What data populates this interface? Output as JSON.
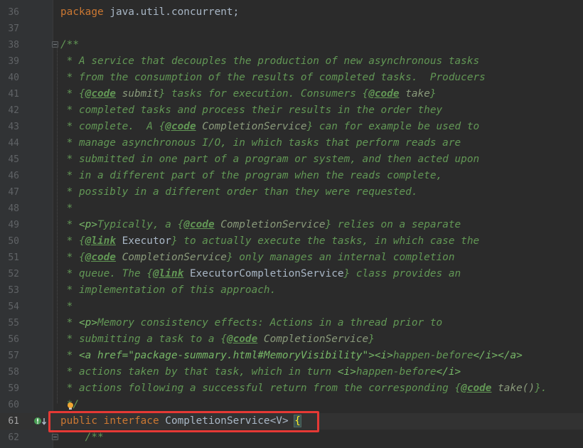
{
  "editor": {
    "file_language": "java",
    "lines": [
      {
        "num": "36",
        "segments": [
          {
            "t": "kw",
            "v": "package"
          },
          {
            "t": "ident",
            "v": " java.util.concurrent;"
          }
        ]
      },
      {
        "num": "37",
        "segments": []
      },
      {
        "num": "38",
        "segments": [
          {
            "t": "cm",
            "v": "/**"
          }
        ]
      },
      {
        "num": "39",
        "segments": [
          {
            "t": "cm",
            "v": " * A service that decouples the production of new asynchronous tasks"
          }
        ]
      },
      {
        "num": "40",
        "segments": [
          {
            "t": "cm",
            "v": " * from the consumption of the results of completed tasks.  Producers"
          }
        ]
      },
      {
        "num": "41",
        "segments": [
          {
            "t": "cm",
            "v": " * {"
          },
          {
            "t": "tg",
            "v": "@code"
          },
          {
            "t": "ref",
            "v": " submit"
          },
          {
            "t": "cm",
            "v": "} tasks for execution. Consumers {"
          },
          {
            "t": "tg",
            "v": "@code"
          },
          {
            "t": "ref",
            "v": " take"
          },
          {
            "t": "cm",
            "v": "}"
          }
        ]
      },
      {
        "num": "42",
        "segments": [
          {
            "t": "cm",
            "v": " * completed tasks and process their results in the order they"
          }
        ]
      },
      {
        "num": "43",
        "segments": [
          {
            "t": "cm",
            "v": " * complete.  A {"
          },
          {
            "t": "tg",
            "v": "@code"
          },
          {
            "t": "ref",
            "v": " CompletionService"
          },
          {
            "t": "cm",
            "v": "} can for example be used to"
          }
        ]
      },
      {
        "num": "44",
        "segments": [
          {
            "t": "cm",
            "v": " * manage asynchronous I/O, in which tasks that perform reads are"
          }
        ]
      },
      {
        "num": "45",
        "segments": [
          {
            "t": "cm",
            "v": " * submitted in one part of a program or system, and then acted upon"
          }
        ]
      },
      {
        "num": "46",
        "segments": [
          {
            "t": "cm",
            "v": " * in a different part of the program when the reads complete,"
          }
        ]
      },
      {
        "num": "47",
        "segments": [
          {
            "t": "cm",
            "v": " * possibly in a different order than they were requested."
          }
        ]
      },
      {
        "num": "48",
        "segments": [
          {
            "t": "cm",
            "v": " *"
          }
        ]
      },
      {
        "num": "49",
        "segments": [
          {
            "t": "cm",
            "v": " * "
          },
          {
            "t": "html-tag",
            "v": "<p>"
          },
          {
            "t": "cm",
            "v": "Typically, a {"
          },
          {
            "t": "tg",
            "v": "@code"
          },
          {
            "t": "ref",
            "v": " CompletionService"
          },
          {
            "t": "cm",
            "v": "} relies on a separate"
          }
        ]
      },
      {
        "num": "50",
        "segments": [
          {
            "t": "cm",
            "v": " * {"
          },
          {
            "t": "tg",
            "v": "@link"
          },
          {
            "t": "ident",
            "v": " Executor"
          },
          {
            "t": "cm",
            "v": "} to actually execute the tasks, in which case the"
          }
        ]
      },
      {
        "num": "51",
        "segments": [
          {
            "t": "cm",
            "v": " * {"
          },
          {
            "t": "tg",
            "v": "@code"
          },
          {
            "t": "ref",
            "v": " CompletionService"
          },
          {
            "t": "cm",
            "v": "} only manages an internal completion"
          }
        ]
      },
      {
        "num": "52",
        "segments": [
          {
            "t": "cm",
            "v": " * queue. The {"
          },
          {
            "t": "tg",
            "v": "@link"
          },
          {
            "t": "ident",
            "v": " ExecutorCompletionService"
          },
          {
            "t": "cm",
            "v": "} class provides an"
          }
        ]
      },
      {
        "num": "53",
        "segments": [
          {
            "t": "cm",
            "v": " * implementation of this approach."
          }
        ]
      },
      {
        "num": "54",
        "segments": [
          {
            "t": "cm",
            "v": " *"
          }
        ]
      },
      {
        "num": "55",
        "segments": [
          {
            "t": "cm",
            "v": " * "
          },
          {
            "t": "html-tag",
            "v": "<p>"
          },
          {
            "t": "cm",
            "v": "Memory consistency effects: Actions in a thread prior to"
          }
        ]
      },
      {
        "num": "56",
        "segments": [
          {
            "t": "cm",
            "v": " * submitting a task to a {"
          },
          {
            "t": "tg",
            "v": "@code"
          },
          {
            "t": "ref",
            "v": " CompletionService"
          },
          {
            "t": "cm",
            "v": "}"
          }
        ]
      },
      {
        "num": "57",
        "segments": [
          {
            "t": "cm",
            "v": " * "
          },
          {
            "t": "html-tag",
            "v": "<a href=\"package-summary.html#MemoryVisibility\">"
          },
          {
            "t": "html-tag",
            "v": "<i>"
          },
          {
            "t": "cm",
            "v": "happen-before"
          },
          {
            "t": "html-tag",
            "v": "</i></a>"
          }
        ]
      },
      {
        "num": "58",
        "segments": [
          {
            "t": "cm",
            "v": " * actions taken by that task, which in turn "
          },
          {
            "t": "html-tag",
            "v": "<i>"
          },
          {
            "t": "cm",
            "v": "happen-before"
          },
          {
            "t": "html-tag",
            "v": "</i>"
          }
        ]
      },
      {
        "num": "59",
        "segments": [
          {
            "t": "cm",
            "v": " * actions following a successful return from the corresponding {"
          },
          {
            "t": "tg",
            "v": "@code"
          },
          {
            "t": "ref",
            "v": " take()"
          },
          {
            "t": "cm",
            "v": "}."
          }
        ]
      },
      {
        "num": "60",
        "segments": [
          {
            "t": "cm",
            "v": " */"
          }
        ]
      },
      {
        "num": "61",
        "segments": [
          {
            "t": "kw",
            "v": "public"
          },
          {
            "t": "ident",
            "v": " "
          },
          {
            "t": "kw",
            "v": "interface"
          },
          {
            "t": "ident",
            "v": " CompletionService<"
          },
          {
            "t": "tp",
            "v": "V"
          },
          {
            "t": "ident",
            "v": "> "
          },
          {
            "t": "brace-hl",
            "v": "{"
          }
        ],
        "current": true
      },
      {
        "num": "62",
        "segments": [
          {
            "t": "cm",
            "v": "    /**"
          }
        ]
      }
    ]
  },
  "colors": {
    "background": "#2b2b2b",
    "gutter": "#313335",
    "keyword": "#cc7832",
    "doc_comment": "#629755",
    "highlight_box": "#e53935"
  },
  "icons": {
    "fold_marker": "fold-icon",
    "intention_bulb": "bulb-icon",
    "implemented_marker": "implemented-icon"
  }
}
